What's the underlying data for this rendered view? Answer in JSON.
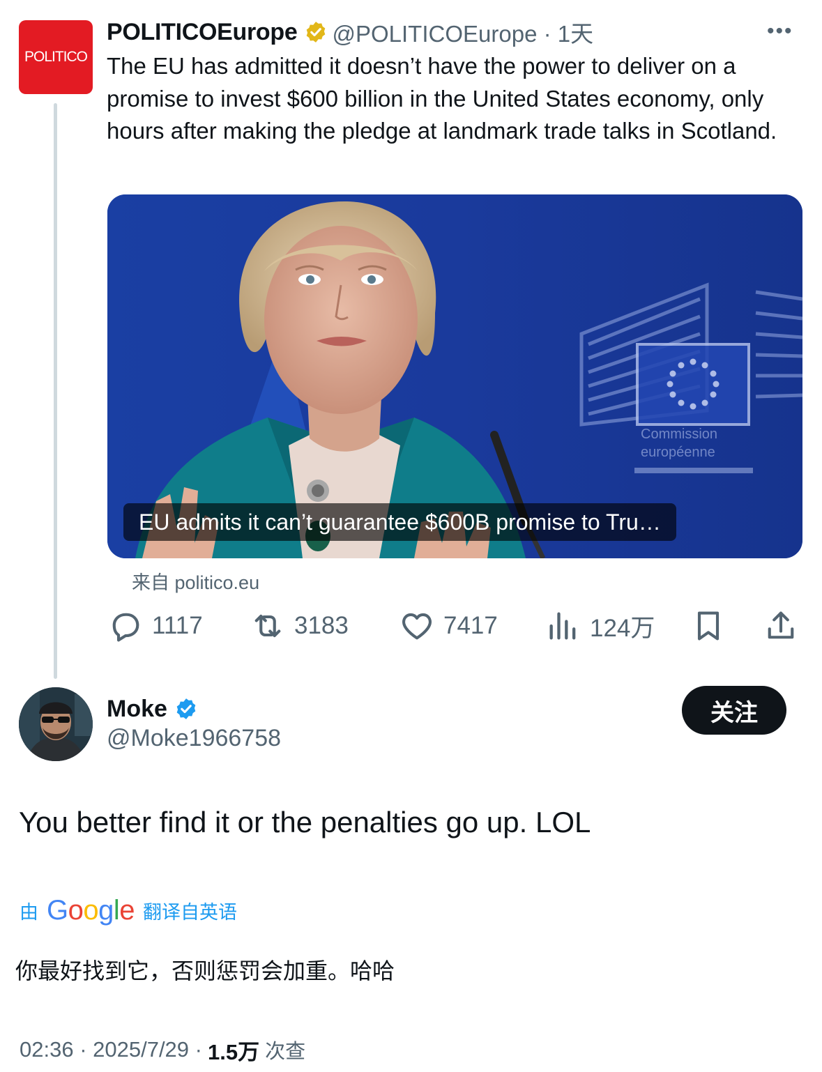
{
  "quoted_tweet": {
    "logo_text": "POLITICO",
    "author_name": "POLITICOEurope",
    "handle_time": "@POLITICOEurope · 1天",
    "text": "The EU has admitted it doesn’t have the power to deliver on a promise to invest $600 billion in the United States economy, only hours after making the pledge at landmark trade talks in Scotland.",
    "media": {
      "caption": "EU admits it can’t guarantee $600B promise to Tru…",
      "sign_text_1": "Commission",
      "sign_text_2": "européenne"
    },
    "source": "来自 politico.eu",
    "stats": {
      "replies": "1117",
      "retweets": "3183",
      "likes": "7417",
      "views": "124万"
    },
    "icons": {
      "verified": "gold-verified-badge-icon",
      "more": "more-dots-icon",
      "reply": "reply-icon",
      "retweet": "retweet-icon",
      "like": "heart-icon",
      "views": "views-chart-icon",
      "bookmark": "bookmark-icon",
      "share": "share-icon"
    },
    "colors": {
      "brand": "#e31b23",
      "gold_badge": "#e2b719"
    }
  },
  "reply_tweet": {
    "author_name": "Moke",
    "handle": "@Moke1966758",
    "follow_label": "关注",
    "text": "You better find it or the penalties go up. LOL",
    "translation": {
      "prefix": "由",
      "google_letters": [
        "G",
        "o",
        "o",
        "g",
        "l",
        "e"
      ],
      "suffix": "翻译自英语",
      "text": "你最好找到它，否则惩罚会加重。哈哈"
    },
    "meta": {
      "time_date": "02:36 · 2025/7/29 ·",
      "views_count": "1.5万",
      "views_label": "次查"
    },
    "colors": {
      "blue_badge": "#1d9bf0",
      "link": "#1d9bf0"
    }
  }
}
